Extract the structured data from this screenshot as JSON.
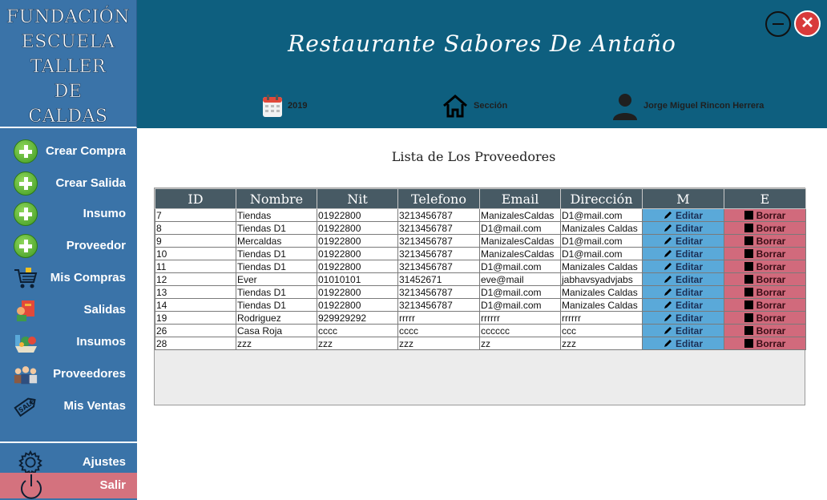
{
  "brand": {
    "lines": [
      "FUNDACIÓN",
      "ESCUELA",
      "TALLER",
      "DE",
      "CALDAS"
    ]
  },
  "sidebar": {
    "items": [
      {
        "label": "Crear Compra",
        "icon": "plus-circle-icon"
      },
      {
        "label": "Crear Salida",
        "icon": "plus-circle-icon"
      },
      {
        "label": "Insumo",
        "icon": "plus-circle-icon"
      },
      {
        "label": "Proveedor",
        "icon": "plus-circle-icon"
      },
      {
        "label": "Mis Compras",
        "icon": "shopping-cart-icon"
      },
      {
        "label": "Salidas",
        "icon": "delivery-icon"
      },
      {
        "label": "Insumos",
        "icon": "groceries-icon"
      },
      {
        "label": "Proveedores",
        "icon": "people-icon"
      },
      {
        "label": "Mis Ventas",
        "icon": "sale-tag-icon"
      }
    ],
    "settings_label": "Ajustes",
    "logout_label": "Salir"
  },
  "header": {
    "title": "Restaurante Sabores De Antaño",
    "year": "2019",
    "section": "Sección",
    "user": "Jorge Miguel Rincon Herrera"
  },
  "main": {
    "list_title": "Lista de Los Proveedores",
    "columns": [
      "ID",
      "Nombre",
      "Nit",
      "Telefono",
      "Email",
      "Dirección",
      "M",
      "E"
    ],
    "edit_label": "Editar",
    "delete_label": "Borrar",
    "rows": [
      [
        "7",
        "Tiendas",
        "01922800",
        "3213456787",
        "ManizalesCaldas",
        "D1@mail.com"
      ],
      [
        "8",
        "Tiendas D1",
        "01922800",
        "3213456787",
        "D1@mail.com",
        "Manizales Caldas"
      ],
      [
        "9",
        "Mercaldas",
        "01922800",
        "3213456787",
        "ManizalesCaldas",
        "D1@mail.com"
      ],
      [
        "10",
        "Tiendas D1",
        "01922800",
        "3213456787",
        "ManizalesCaldas",
        "D1@mail.com"
      ],
      [
        "11",
        "Tiendas D1",
        "01922800",
        "3213456787",
        "D1@mail.com",
        "Manizales Caldas"
      ],
      [
        "12",
        "Ever",
        "01010101",
        "31452671",
        "eve@mail",
        "jabhavsyadvjabs"
      ],
      [
        "13",
        "Tiendas D1",
        "01922800",
        "3213456787",
        "D1@mail.com",
        "Manizales Caldas"
      ],
      [
        "14",
        "Tiendas D1",
        "01922800",
        "3213456787",
        "D1@mail.com",
        "Manizales Caldas"
      ],
      [
        "19",
        "Rodriguez",
        "929929292",
        "rrrrr",
        "rrrrrr",
        "rrrrrr"
      ],
      [
        "26",
        "Casa Roja",
        "cccc",
        "cccc",
        "cccccc",
        "ccc"
      ],
      [
        "28",
        "zzz",
        "zzz",
        "zzz",
        "zz",
        "zzz"
      ]
    ]
  }
}
